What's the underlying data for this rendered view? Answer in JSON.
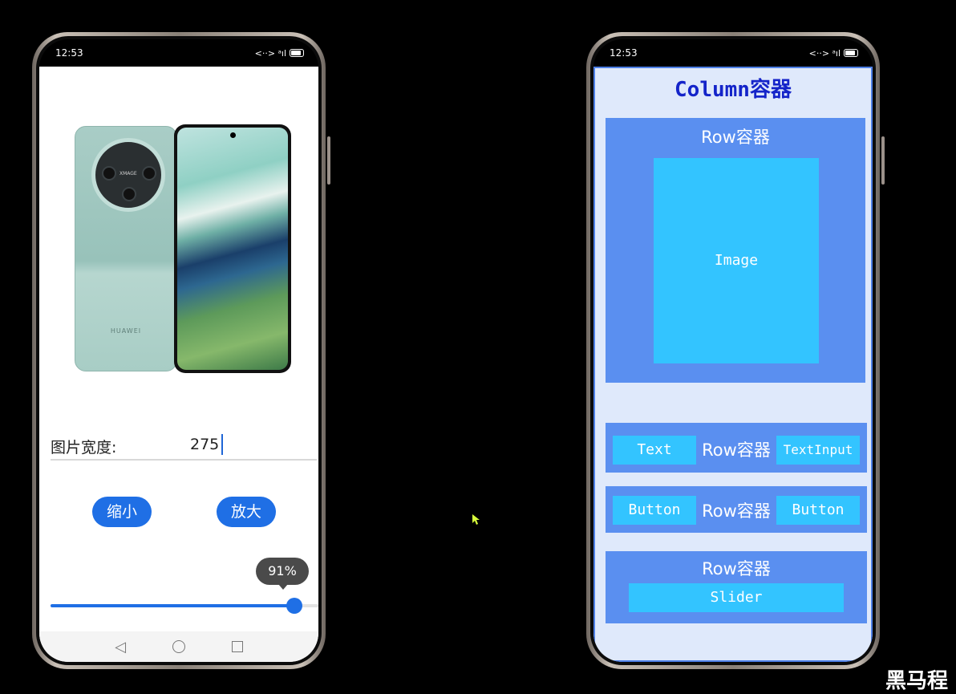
{
  "left_phone": {
    "status": {
      "time": "12:53",
      "icons": "<··> ᵃıl"
    },
    "image": {
      "brand_small": "XMAGE",
      "brand": "HUAWEI"
    },
    "width_label": "图片宽度:",
    "width_value": "275",
    "buttons": {
      "shrink": "缩小",
      "enlarge": "放大"
    },
    "slider": {
      "tooltip": "91%",
      "value_percent": 91
    },
    "nav": {
      "back": "◁"
    }
  },
  "right_phone": {
    "status": {
      "time": "12:53",
      "icons": "<··> ᵃıl"
    },
    "column_title": "Column容器",
    "row1": {
      "label": "Row容器",
      "image_label": "Image"
    },
    "row2": {
      "left": "Text",
      "label": "Row容器",
      "right": "TextInput"
    },
    "row3": {
      "left": "Button",
      "label": "Row容器",
      "right": "Button"
    },
    "row4": {
      "label": "Row容器",
      "slider_label": "Slider"
    }
  },
  "watermark": "黑马程"
}
